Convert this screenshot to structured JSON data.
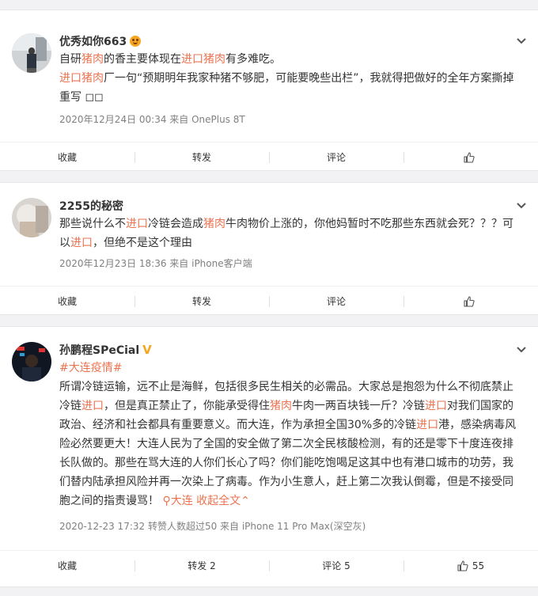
{
  "posts": [
    {
      "username": "优秀如你663",
      "line1": [
        {
          "t": "自研",
          "c": ""
        },
        {
          "t": "猪肉",
          "c": "hl"
        },
        {
          "t": "的香主要体现在",
          "c": ""
        },
        {
          "t": "进口猪肉",
          "c": "hl"
        },
        {
          "t": "有多难吃。",
          "c": ""
        }
      ],
      "line2": [
        {
          "t": "进口猪肉",
          "c": "hl"
        },
        {
          "t": "厂一句“预期明年我家种猪不够肥，可能要晚些出栏”，我就得把做好的全年方案撕掉重写 ◻◻",
          "c": ""
        }
      ],
      "meta": "2020年12月24日 00:34  来自 OnePlus 8T",
      "actions": {
        "favorite": "收藏",
        "repost": "转发",
        "comment": "评论",
        "like": ""
      }
    },
    {
      "username": "2255的秘密",
      "line1": [
        {
          "t": "那些说什么不",
          "c": ""
        },
        {
          "t": "进口",
          "c": "hl"
        },
        {
          "t": "冷链会造成",
          "c": ""
        },
        {
          "t": "猪肉",
          "c": "hl"
        },
        {
          "t": "牛肉物价上涨的，你他妈暂时不吃那些东西就会死？？？可以",
          "c": ""
        },
        {
          "t": "进口",
          "c": "hl"
        },
        {
          "t": "，但绝不是这个理由",
          "c": ""
        }
      ],
      "meta": "2020年12月23日 18:36  来自 iPhone客户端",
      "actions": {
        "favorite": "收藏",
        "repost": "转发",
        "comment": "评论",
        "like": ""
      }
    },
    {
      "username": "孙鹏程SPeCial",
      "topic": "#大连疫情#",
      "body": [
        {
          "t": "所谓冷链运输，远不止是海鲜，包括很多民生相关的必需品。大家总是抱怨为什么不彻底禁止冷链",
          "c": ""
        },
        {
          "t": "进口",
          "c": "hl"
        },
        {
          "t": "，但是真正禁止了，你能承受得住",
          "c": ""
        },
        {
          "t": "猪肉",
          "c": "hl"
        },
        {
          "t": "牛肉一两百块钱一斤？冷链",
          "c": ""
        },
        {
          "t": "进口",
          "c": "hl"
        },
        {
          "t": "对我们国家的政治、经济和社会都具有重要意义。而大连，作为承担全国30%多的冷链",
          "c": ""
        },
        {
          "t": "进口",
          "c": "hl"
        },
        {
          "t": "港，感染病毒风险必然要更大！大连人民为了全国的安全做了第二次全民核酸检测，有的还是零下十度连夜排长队做的。那些在骂大连的人你们长心了吗？你们能吃饱喝足这其中也有港口城市的功劳，我们替内陆承担风险并再一次染上了病毒。作为小生意人，赶上第二次我认倒霉，但是不接受同胞之间的指责谩骂！",
          "c": ""
        }
      ],
      "location": "大连",
      "expand": "收起全文",
      "meta": "2020-12-23 17:32 转赞人数超过50  来自 iPhone 11 Pro Max(深空灰)",
      "actions": {
        "favorite": "收藏",
        "repost": "转发 2",
        "comment": "评论 5",
        "like": "55"
      }
    }
  ]
}
